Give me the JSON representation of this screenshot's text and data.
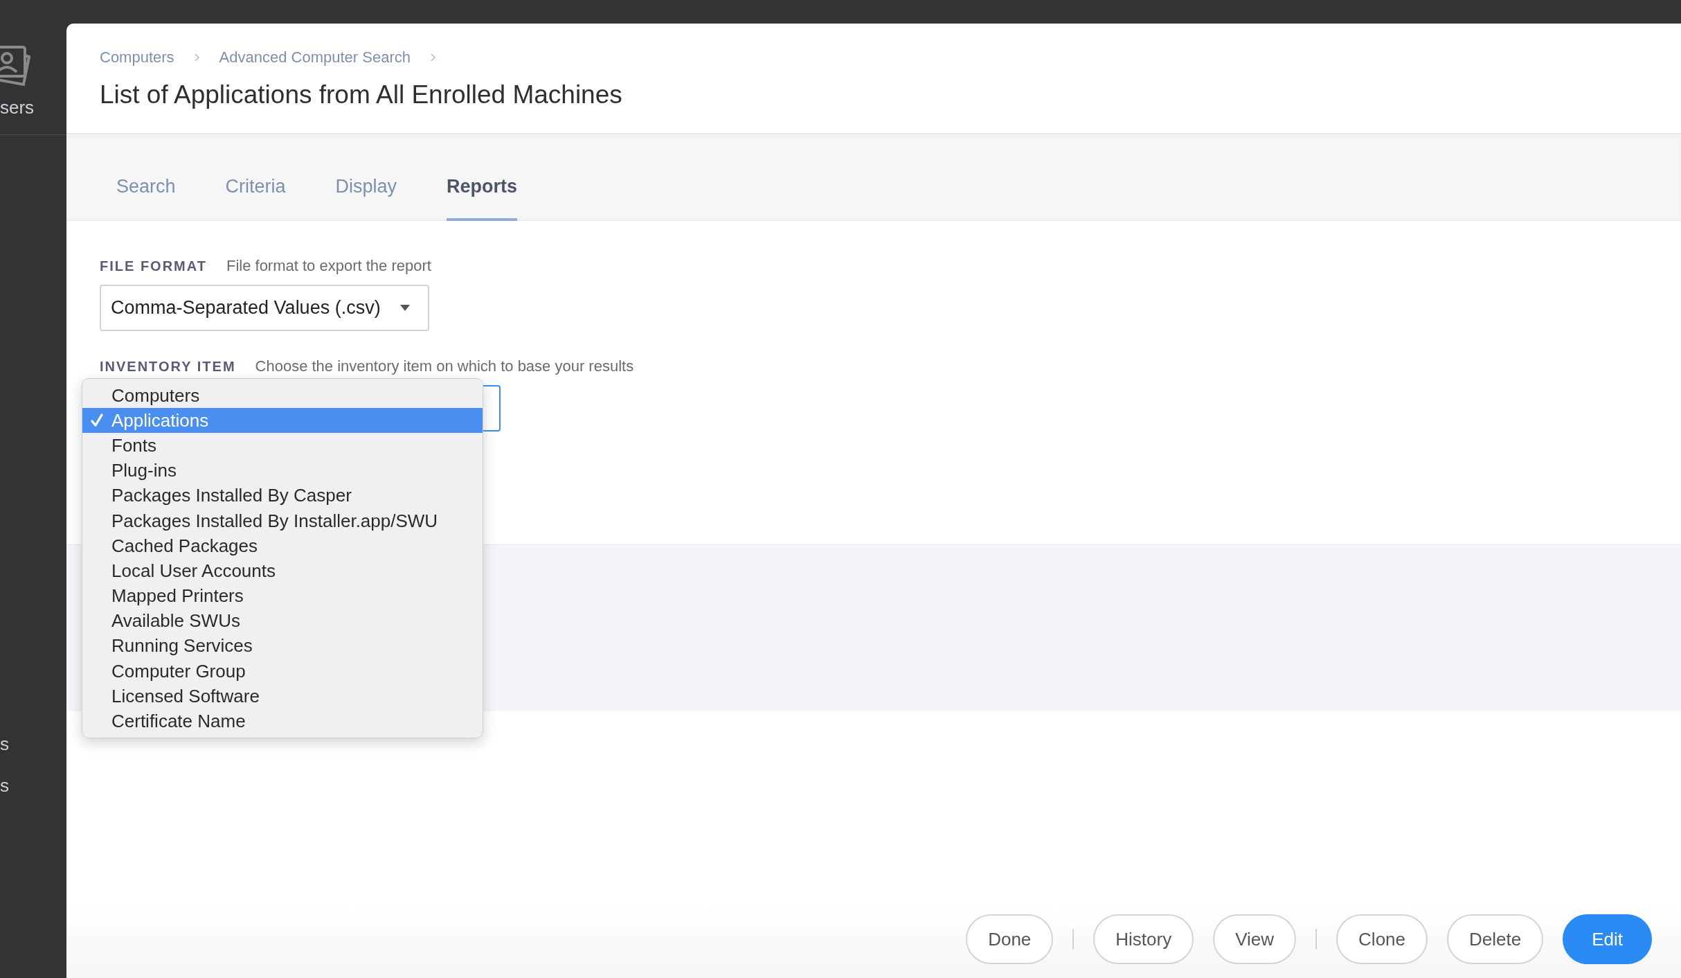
{
  "sidebar": {
    "top_label": "sers",
    "items": [
      "s",
      "s"
    ]
  },
  "breadcrumb": [
    "Computers",
    "Advanced Computer Search"
  ],
  "title": "List of Applications from All Enrolled Machines",
  "tabs": [
    {
      "label": "Search",
      "selected": false
    },
    {
      "label": "Criteria",
      "selected": false
    },
    {
      "label": "Display",
      "selected": false
    },
    {
      "label": "Reports",
      "selected": true
    }
  ],
  "file_format": {
    "label": "FILE FORMAT",
    "hint": "File format to export the report",
    "value": "Comma-Separated Values (.csv)"
  },
  "inventory_item": {
    "label": "INVENTORY ITEM",
    "hint": "Choose the inventory item on which to base your results",
    "menu": [
      {
        "label": "Computers",
        "selected": false
      },
      {
        "label": "Applications",
        "selected": true
      },
      {
        "label": "Fonts",
        "selected": false
      },
      {
        "label": "Plug-ins",
        "selected": false
      },
      {
        "label": "Packages Installed By Casper",
        "selected": false
      },
      {
        "label": "Packages Installed By Installer.app/SWU",
        "selected": false
      },
      {
        "label": "Cached Packages",
        "selected": false
      },
      {
        "label": "Local User Accounts",
        "selected": false
      },
      {
        "label": "Mapped Printers",
        "selected": false
      },
      {
        "label": "Available SWUs",
        "selected": false
      },
      {
        "label": "Running Services",
        "selected": false
      },
      {
        "label": "Computer Group",
        "selected": false
      },
      {
        "label": "Licensed Software",
        "selected": false
      },
      {
        "label": "Certificate Name",
        "selected": false
      }
    ]
  },
  "footer": {
    "buttons": [
      {
        "kind": "default",
        "label": "Done"
      },
      {
        "kind": "separator"
      },
      {
        "kind": "default",
        "label": "History"
      },
      {
        "kind": "default",
        "label": "View"
      },
      {
        "kind": "separator"
      },
      {
        "kind": "default",
        "label": "Clone"
      },
      {
        "kind": "default",
        "label": "Delete"
      },
      {
        "kind": "primary",
        "label": "Edit"
      }
    ]
  }
}
